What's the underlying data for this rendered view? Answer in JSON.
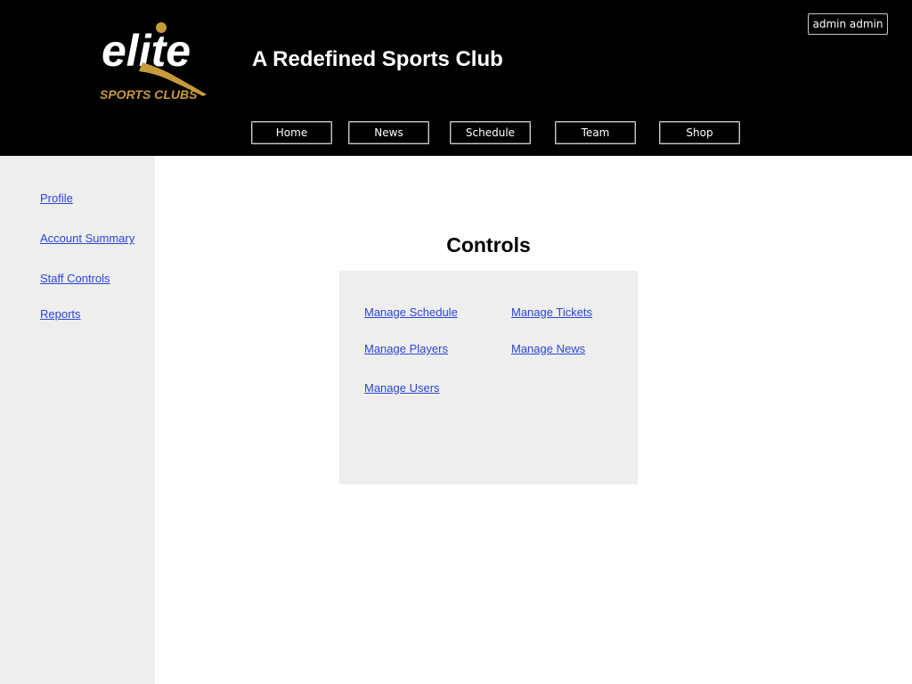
{
  "header": {
    "logo": {
      "word": "elite",
      "tagline": "SPORTS CLUBS"
    },
    "site_title": "A Redefined Sports Club",
    "user_label": "admin admin",
    "nav": [
      "Home",
      "News",
      "Schedule",
      "Team",
      "Shop"
    ]
  },
  "sidebar": {
    "links": [
      "Profile",
      "Account Summary",
      "Staff Controls",
      "Reports"
    ]
  },
  "main": {
    "title": "Controls",
    "controls": [
      "Manage Schedule",
      "Manage Tickets",
      "Manage Players",
      "Manage News",
      "Manage Users"
    ]
  },
  "colors": {
    "header_bg": "#000000",
    "panel_bg": "#eeeeee",
    "link": "#2a46d8",
    "logo_gold": "#c79a3a"
  }
}
